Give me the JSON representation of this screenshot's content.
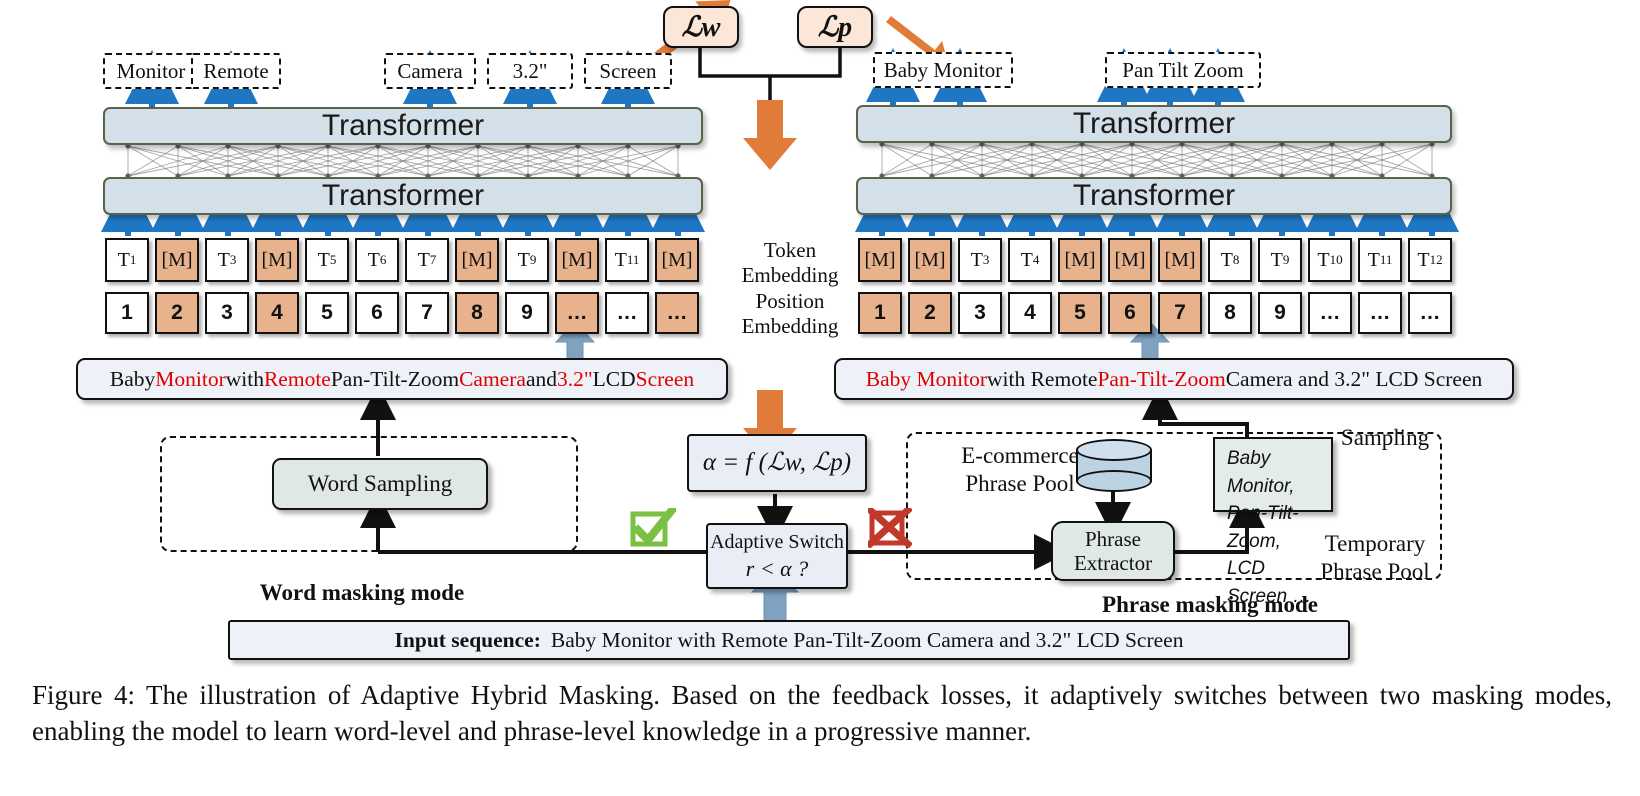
{
  "figure": {
    "caption": "Figure 4: The illustration of Adaptive Hybrid Masking. Based on the feedback losses, it adaptively switches between two masking modes, enabling the model to learn word-level and phrase-level knowledge in a progressive manner.",
    "colors": {
      "mask_token": "#e8b38c",
      "transformer": "#d3dfe9",
      "transformer_border": "#5a6348",
      "loss_box": "#fbe6d8",
      "green_box": "#dfe8e2",
      "blue_box": "#e8edf6",
      "arrow_blue": "#1f77c4",
      "arrow_orange": "#e07b39",
      "arrow_steel": "#7fa2c0",
      "highlight_red": "#e00000",
      "check_green": "#7ac143",
      "cross_red": "#c0392b"
    }
  },
  "word_branch": {
    "predictions": [
      "Monitor",
      "Remote",
      "Camera",
      "3.2\"",
      "Screen"
    ],
    "transformer_label": "Transformer",
    "tokens": [
      "T1",
      "[M]",
      "T3",
      "[M]",
      "T5",
      "T6",
      "T7",
      "[M]",
      "T9",
      "[M]",
      "T11",
      "[M]"
    ],
    "token_masked": [
      false,
      true,
      false,
      true,
      false,
      false,
      false,
      true,
      false,
      true,
      false,
      true
    ],
    "positions": [
      "1",
      "2",
      "3",
      "4",
      "5",
      "6",
      "7",
      "8",
      "9",
      "…",
      "…",
      "…"
    ],
    "position_masked": [
      false,
      true,
      false,
      true,
      false,
      false,
      false,
      true,
      false,
      true,
      false,
      true
    ],
    "sentence_parts": [
      {
        "text": "Baby ",
        "red": false
      },
      {
        "text": "Monitor",
        "red": true
      },
      {
        "text": " with ",
        "red": false
      },
      {
        "text": "Remote",
        "red": true
      },
      {
        "text": " Pan-Tilt-Zoom ",
        "red": false
      },
      {
        "text": "Camera",
        "red": true
      },
      {
        "text": " and ",
        "red": false
      },
      {
        "text": "3.2\"",
        "red": true
      },
      {
        "text": " LCD ",
        "red": false
      },
      {
        "text": "Screen",
        "red": true
      }
    ],
    "word_sampling_label": "Word Sampling",
    "mode_label": "Word masking mode"
  },
  "phrase_branch": {
    "predictions": [
      "Baby Monitor",
      "Pan  Tilt  Zoom"
    ],
    "prediction_groups": [
      {
        "label": "Baby Monitor",
        "arrows": 2
      },
      {
        "label": "Pan  Tilt  Zoom",
        "arrows": 3
      }
    ],
    "transformer_label": "Transformer",
    "tokens": [
      "[M]",
      "[M]",
      "T3",
      "T4",
      "[M]",
      "[M]",
      "[M]",
      "T8",
      "T9",
      "T10",
      "T11",
      "T12"
    ],
    "token_masked": [
      true,
      true,
      false,
      false,
      true,
      true,
      true,
      false,
      false,
      false,
      false,
      false
    ],
    "positions": [
      "1",
      "2",
      "3",
      "4",
      "5",
      "6",
      "7",
      "8",
      "9",
      "…",
      "…",
      "…"
    ],
    "position_masked": [
      true,
      true,
      false,
      false,
      true,
      true,
      true,
      false,
      false,
      false,
      false,
      false
    ],
    "sentence_parts": [
      {
        "text": "Baby Monitor",
        "red": true
      },
      {
        "text": " with Remote ",
        "red": false
      },
      {
        "text": "Pan-Tilt-Zoom",
        "red": true
      },
      {
        "text": " Camera and 3.2\" LCD Screen",
        "red": false
      }
    ],
    "pool_label_line1": "E-commerce",
    "pool_label_line2": "Phrase Pool",
    "extractor_label_line1": "Phrase",
    "extractor_label_line2": "Extractor",
    "sampling_label": "Sampling",
    "temp_pool_line1": "Temporary",
    "temp_pool_line2": "Phrase Pool",
    "temp_pool_items": [
      "Baby  Monitor,",
      "Pan-Tilt-Zoom,",
      "LCD Screen …"
    ],
    "mode_label": "Phrase masking mode"
  },
  "center": {
    "loss_word": "ℒw",
    "loss_phrase": "ℒp",
    "alpha_formula": "α = f (ℒw, ℒp)",
    "switch_title": "Adaptive Switch",
    "switch_condition": "r < α ?",
    "token_embedding_line1": "Token",
    "token_embedding_line2": "Embedding",
    "position_embedding_line1": "Position",
    "position_embedding_line2": "Embedding",
    "check_icon": "check-mark-icon",
    "cross_icon": "cross-mark-icon"
  },
  "input_bar": {
    "label": "Input sequence:",
    "text": "Baby Monitor with Remote Pan-Tilt-Zoom  Camera and 3.2\" LCD Screen"
  }
}
